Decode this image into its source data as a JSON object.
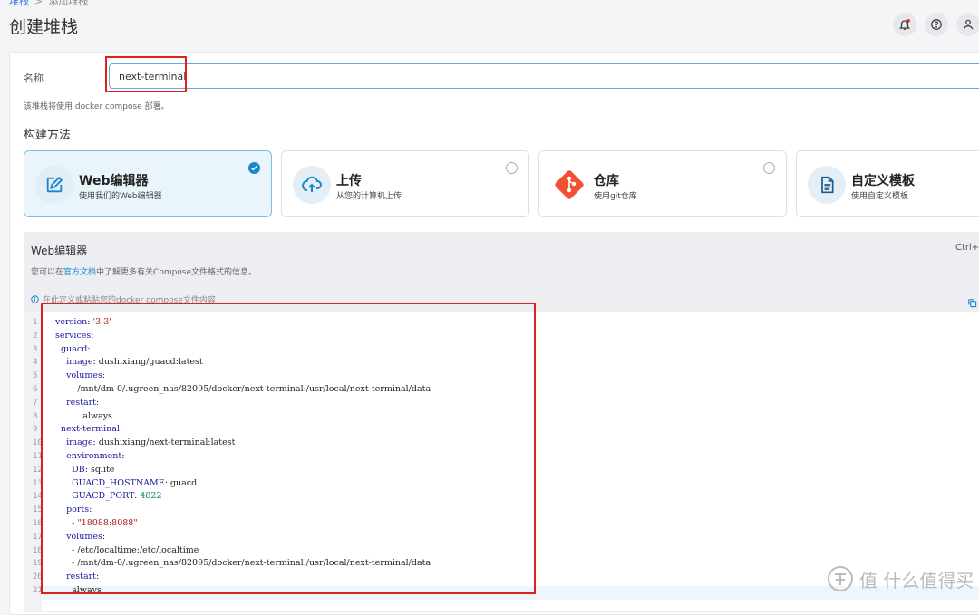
{
  "breadcrumb": {
    "parent": "堆栈",
    "separator": ">",
    "current": "添加堆栈"
  },
  "page": {
    "title": "创建堆栈"
  },
  "header_icons": [
    "bell-icon",
    "help-icon",
    "user-icon"
  ],
  "name_field": {
    "label": "名称",
    "value": "next-terminal"
  },
  "hint": "该堆栈将使用 docker compose 部署。",
  "build_method": {
    "title": "构建方法",
    "options": [
      {
        "title": "Web编辑器",
        "subtitle": "使用我们的Web编辑器",
        "icon": "edit-icon",
        "selected": true
      },
      {
        "title": "上传",
        "subtitle": "从您的计算机上传",
        "icon": "upload-cloud-icon",
        "selected": false
      },
      {
        "title": "仓库",
        "subtitle": "使用git仓库",
        "icon": "git-icon",
        "selected": false
      },
      {
        "title": "自定义模板",
        "subtitle": "使用自定义模板",
        "icon": "template-icon",
        "selected": false
      }
    ]
  },
  "editor": {
    "title": "Web编辑器",
    "shortcut": "Ctrl+",
    "doc_prefix": "您可以在",
    "doc_link": "官方文档",
    "doc_suffix": "中了解更多有关Compose文件格式的信息。",
    "info": "在此定义或粘贴您的docker compose文件内容"
  },
  "code_lines": [
    "version: '3.3'",
    "services:",
    "  guacd:",
    "    image: dushixiang/guacd:latest",
    "    volumes:",
    "      - /mnt/dm-0/.ugreen_nas/82095/docker/next-terminal:/usr/local/next-terminal/data",
    "    restart:",
    "          always",
    "  next-terminal:",
    "    image: dushixiang/next-terminal:latest",
    "    environment:",
    "      DB: sqlite",
    "      GUACD_HOSTNAME: guacd",
    "      GUACD_PORT: 4822",
    "    ports:",
    "      - \"18088:8088\"",
    "    volumes:",
    "      - /etc/localtime:/etc/localtime",
    "      - /mnt/dm-0/.ugreen_nas/82095/docker/next-terminal:/usr/local/next-terminal/data",
    "    restart:",
    "      always"
  ],
  "watermark": "值 什么值得买",
  "colors": {
    "accent": "#1a86d0",
    "highlight": "#e02020",
    "selected_bg": "#e9f4fb",
    "git": "#f05133"
  }
}
